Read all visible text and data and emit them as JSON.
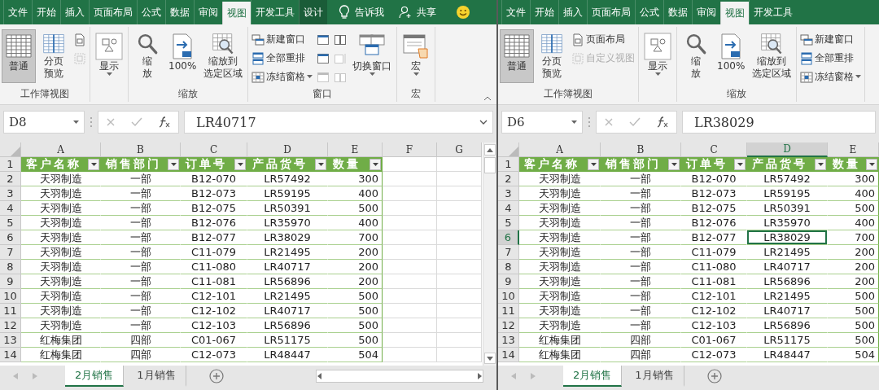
{
  "windows": [
    {
      "ribbon_tabs": [
        {
          "label": "文件",
          "kind": "normal",
          "selected": false
        },
        {
          "label": "开始",
          "kind": "normal",
          "selected": false
        },
        {
          "label": "插入",
          "kind": "normal",
          "selected": false
        },
        {
          "label": "页面布局",
          "kind": "normal",
          "selected": false
        },
        {
          "label": "公式",
          "kind": "normal",
          "selected": false
        },
        {
          "label": "数据",
          "kind": "normal",
          "selected": false
        },
        {
          "label": "审阅",
          "kind": "normal",
          "selected": false
        },
        {
          "label": "视图",
          "kind": "normal",
          "selected": true
        },
        {
          "label": "开发工具",
          "kind": "normal",
          "selected": false
        },
        {
          "label": "设计",
          "kind": "contextual",
          "selected": false
        }
      ],
      "tell_me": "告诉我",
      "share": "共享",
      "ribbon_groups": [
        {
          "label": "工作簿视图",
          "items": [
            {
              "kind": "normal",
              "label": "普通",
              "selected": true,
              "disabled": false,
              "dropdown": false
            },
            {
              "kind": "pagebreak",
              "label": "分页预览",
              "wrap": true,
              "selected": false,
              "disabled": false,
              "dropdown": false
            },
            {
              "kind": "pagelayout",
              "selected": false,
              "disabled": false,
              "dropdown": false
            },
            {
              "kind": "customview",
              "selected": false,
              "disabled": true,
              "dropdown": false
            }
          ]
        },
        {
          "items": [
            {
              "kind": "show",
              "label": "显示",
              "selected": false,
              "disabled": false,
              "dropdown": true
            }
          ]
        },
        {
          "label": "缩放",
          "items": [
            {
              "kind": "zoom",
              "label": "缩放",
              "wrap": true,
              "selected": false,
              "disabled": false,
              "dropdown": false
            },
            {
              "kind": "zoom100",
              "label": "100%",
              "wrap": false,
              "selected": false,
              "disabled": false,
              "dropdown": false
            },
            {
              "kind": "zoomsel",
              "label": "缩放到选定区域",
              "wrap": true,
              "selected": false,
              "disabled": false,
              "dropdown": false
            }
          ]
        },
        {
          "label": "窗口",
          "items": [
            {
              "kind": "newwindow",
              "label": "新建窗口",
              "selected": false,
              "disabled": false,
              "dropdown": false
            },
            {
              "kind": "arrange",
              "label": "全部重排",
              "selected": false,
              "disabled": false,
              "dropdown": false
            },
            {
              "kind": "freeze",
              "label": "冻结窗格",
              "selected": false,
              "disabled": false,
              "dropdown": true
            },
            {
              "kind": "split",
              "selected": false,
              "disabled": false,
              "dropdown": false
            },
            {
              "kind": "hide",
              "selected": false,
              "disabled": false,
              "dropdown": false
            },
            {
              "kind": "unhide",
              "selected": false,
              "disabled": true,
              "dropdown": false
            },
            {
              "kind": "sidebyside",
              "selected": false,
              "disabled": false,
              "dropdown": false
            },
            {
              "kind": "sync",
              "selected": false,
              "disabled": true,
              "dropdown": false
            },
            {
              "kind": "reset",
              "selected": false,
              "disabled": true,
              "dropdown": false
            },
            {
              "kind": "switch",
              "label": "切换窗口",
              "selected": false,
              "disabled": false,
              "dropdown": true
            }
          ]
        },
        {
          "label": "宏",
          "items": [
            {
              "kind": "macro",
              "label": "宏",
              "selected": false,
              "disabled": false,
              "dropdown": true
            }
          ]
        }
      ],
      "name_box": "D8",
      "formula": "LR40717",
      "columns": [
        {
          "label": "A",
          "selected": false
        },
        {
          "label": "B",
          "selected": false
        },
        {
          "label": "C",
          "selected": false
        },
        {
          "label": "D",
          "selected": false
        },
        {
          "label": "E",
          "selected": false
        },
        {
          "label": "F",
          "selected": false
        },
        {
          "label": "G",
          "selected": false
        }
      ],
      "rows": [
        {
          "number": "1",
          "kind": "header",
          "selected": false,
          "cells": [
            "客户名称",
            "销售部门",
            "订单号",
            "产品货号",
            "数量"
          ]
        },
        {
          "number": "2",
          "kind": "data",
          "selected": false,
          "cells": [
            "天羽制造",
            "一部",
            "B12-070",
            "LR57492",
            "300"
          ]
        },
        {
          "number": "3",
          "kind": "data",
          "selected": false,
          "cells": [
            "天羽制造",
            "一部",
            "B12-073",
            "LR59195",
            "400"
          ]
        },
        {
          "number": "4",
          "kind": "data",
          "selected": false,
          "cells": [
            "天羽制造",
            "一部",
            "B12-075",
            "LR50391",
            "500"
          ]
        },
        {
          "number": "5",
          "kind": "data",
          "selected": false,
          "cells": [
            "天羽制造",
            "一部",
            "B12-076",
            "LR35970",
            "400"
          ]
        },
        {
          "number": "6",
          "kind": "data",
          "selected": false,
          "cells": [
            "天羽制造",
            "一部",
            "B12-077",
            "LR38029",
            "700"
          ]
        },
        {
          "number": "7",
          "kind": "data",
          "selected": false,
          "cells": [
            "天羽制造",
            "一部",
            "C11-079",
            "LR21495",
            "200"
          ]
        },
        {
          "number": "8",
          "kind": "data",
          "selected": false,
          "cells": [
            "天羽制造",
            "一部",
            "C11-080",
            "LR40717",
            "200"
          ]
        },
        {
          "number": "9",
          "kind": "data",
          "selected": false,
          "cells": [
            "天羽制造",
            "一部",
            "C11-081",
            "LR56896",
            "200"
          ]
        },
        {
          "number": "10",
          "kind": "data",
          "selected": false,
          "cells": [
            "天羽制造",
            "一部",
            "C12-101",
            "LR21495",
            "500"
          ]
        },
        {
          "number": "11",
          "kind": "data",
          "selected": false,
          "cells": [
            "天羽制造",
            "一部",
            "C12-102",
            "LR40717",
            "500"
          ]
        },
        {
          "number": "12",
          "kind": "data",
          "selected": false,
          "cells": [
            "天羽制造",
            "一部",
            "C12-103",
            "LR56896",
            "500"
          ]
        },
        {
          "number": "13",
          "kind": "data",
          "selected": false,
          "cells": [
            "红梅集团",
            "四部",
            "C01-067",
            "LR51175",
            "500"
          ]
        },
        {
          "number": "14",
          "kind": "data",
          "selected": false,
          "cells": [
            "红梅集团",
            "四部",
            "C12-073",
            "LR48447",
            "504"
          ]
        }
      ],
      "sheet_tabs": [
        {
          "label": "2月销售",
          "selected": true
        },
        {
          "label": "1月销售",
          "selected": false
        }
      ]
    },
    {
      "ribbon_tabs": [
        {
          "label": "文件",
          "kind": "normal",
          "selected": false
        },
        {
          "label": "开始",
          "kind": "normal",
          "selected": false
        },
        {
          "label": "插入",
          "kind": "normal",
          "selected": false
        },
        {
          "label": "页面布局",
          "kind": "normal",
          "selected": false
        },
        {
          "label": "公式",
          "kind": "normal",
          "selected": false
        },
        {
          "label": "数据",
          "kind": "normal",
          "selected": false
        },
        {
          "label": "审阅",
          "kind": "normal",
          "selected": false
        },
        {
          "label": "视图",
          "kind": "normal",
          "selected": true
        },
        {
          "label": "开发工具",
          "kind": "normal",
          "selected": false
        }
      ],
      "ribbon_groups": [
        {
          "label": "工作簿视图",
          "items": [
            {
              "kind": "normal",
              "label": "普通",
              "selected": true,
              "disabled": false,
              "dropdown": false
            },
            {
              "kind": "pagebreak",
              "label": "分页预览",
              "wrap": true,
              "selected": false,
              "disabled": false,
              "dropdown": false
            },
            {
              "kind": "pagelayout",
              "label": "页面布局",
              "selected": false,
              "disabled": false,
              "dropdown": false
            },
            {
              "kind": "customview",
              "label": "自定义视图",
              "selected": false,
              "disabled": true,
              "dropdown": false
            }
          ]
        },
        {
          "items": [
            {
              "kind": "show",
              "label": "显示",
              "selected": false,
              "disabled": false,
              "dropdown": true
            }
          ]
        },
        {
          "label": "缩放",
          "items": [
            {
              "kind": "zoom",
              "label": "缩放",
              "wrap": true,
              "selected": false,
              "disabled": false,
              "dropdown": false
            },
            {
              "kind": "zoom100",
              "label": "100%",
              "wrap": false,
              "selected": false,
              "disabled": false,
              "dropdown": false
            },
            {
              "kind": "zoomsel",
              "label": "缩放到选定区域",
              "wrap": true,
              "selected": false,
              "disabled": false,
              "dropdown": false
            }
          ]
        },
        {
          "items": [
            {
              "kind": "newwindow",
              "label": "新建窗口",
              "selected": false,
              "disabled": false,
              "dropdown": false
            },
            {
              "kind": "arrange",
              "label": "全部重排",
              "selected": false,
              "disabled": false,
              "dropdown": false
            },
            {
              "kind": "freeze",
              "label": "冻结窗格",
              "selected": false,
              "disabled": false,
              "dropdown": true
            }
          ]
        }
      ],
      "name_box": "D6",
      "formula": "LR38029",
      "columns": [
        {
          "label": "A",
          "selected": false
        },
        {
          "label": "B",
          "selected": false
        },
        {
          "label": "C",
          "selected": false
        },
        {
          "label": "D",
          "selected": true
        },
        {
          "label": "E",
          "selected": false
        }
      ],
      "rows": [
        {
          "number": "1",
          "kind": "header",
          "selected": false,
          "cells": [
            "客户名称",
            "销售部门",
            "订单号",
            "产品货号",
            "数量"
          ]
        },
        {
          "number": "2",
          "kind": "data",
          "selected": false,
          "cells": [
            "天羽制造",
            "一部",
            "B12-070",
            "LR57492",
            "300"
          ]
        },
        {
          "number": "3",
          "kind": "data",
          "selected": false,
          "cells": [
            "天羽制造",
            "一部",
            "B12-073",
            "LR59195",
            "400"
          ]
        },
        {
          "number": "4",
          "kind": "data",
          "selected": false,
          "cells": [
            "天羽制造",
            "一部",
            "B12-075",
            "LR50391",
            "500"
          ]
        },
        {
          "number": "5",
          "kind": "data",
          "selected": false,
          "cells": [
            "天羽制造",
            "一部",
            "B12-076",
            "LR35970",
            "400"
          ]
        },
        {
          "number": "6",
          "kind": "data",
          "selected": true,
          "cells": [
            "天羽制造",
            "一部",
            "B12-077",
            "LR38029",
            "700"
          ]
        },
        {
          "number": "7",
          "kind": "data",
          "selected": false,
          "cells": [
            "天羽制造",
            "一部",
            "C11-079",
            "LR21495",
            "200"
          ]
        },
        {
          "number": "8",
          "kind": "data",
          "selected": false,
          "cells": [
            "天羽制造",
            "一部",
            "C11-080",
            "LR40717",
            "200"
          ]
        },
        {
          "number": "9",
          "kind": "data",
          "selected": false,
          "cells": [
            "天羽制造",
            "一部",
            "C11-081",
            "LR56896",
            "200"
          ]
        },
        {
          "number": "10",
          "kind": "data",
          "selected": false,
          "cells": [
            "天羽制造",
            "一部",
            "C12-101",
            "LR21495",
            "500"
          ]
        },
        {
          "number": "11",
          "kind": "data",
          "selected": false,
          "cells": [
            "天羽制造",
            "一部",
            "C12-102",
            "LR40717",
            "500"
          ]
        },
        {
          "number": "12",
          "kind": "data",
          "selected": false,
          "cells": [
            "天羽制造",
            "一部",
            "C12-103",
            "LR56896",
            "500"
          ]
        },
        {
          "number": "13",
          "kind": "data",
          "selected": false,
          "cells": [
            "红梅集团",
            "四部",
            "C01-067",
            "LR51175",
            "500"
          ]
        },
        {
          "number": "14",
          "kind": "data",
          "selected": false,
          "cells": [
            "红梅集团",
            "四部",
            "C12-073",
            "LR48447",
            "504"
          ]
        }
      ],
      "sheet_tabs": [
        {
          "label": "2月销售",
          "selected": true
        },
        {
          "label": "1月销售",
          "selected": false
        }
      ]
    }
  ]
}
